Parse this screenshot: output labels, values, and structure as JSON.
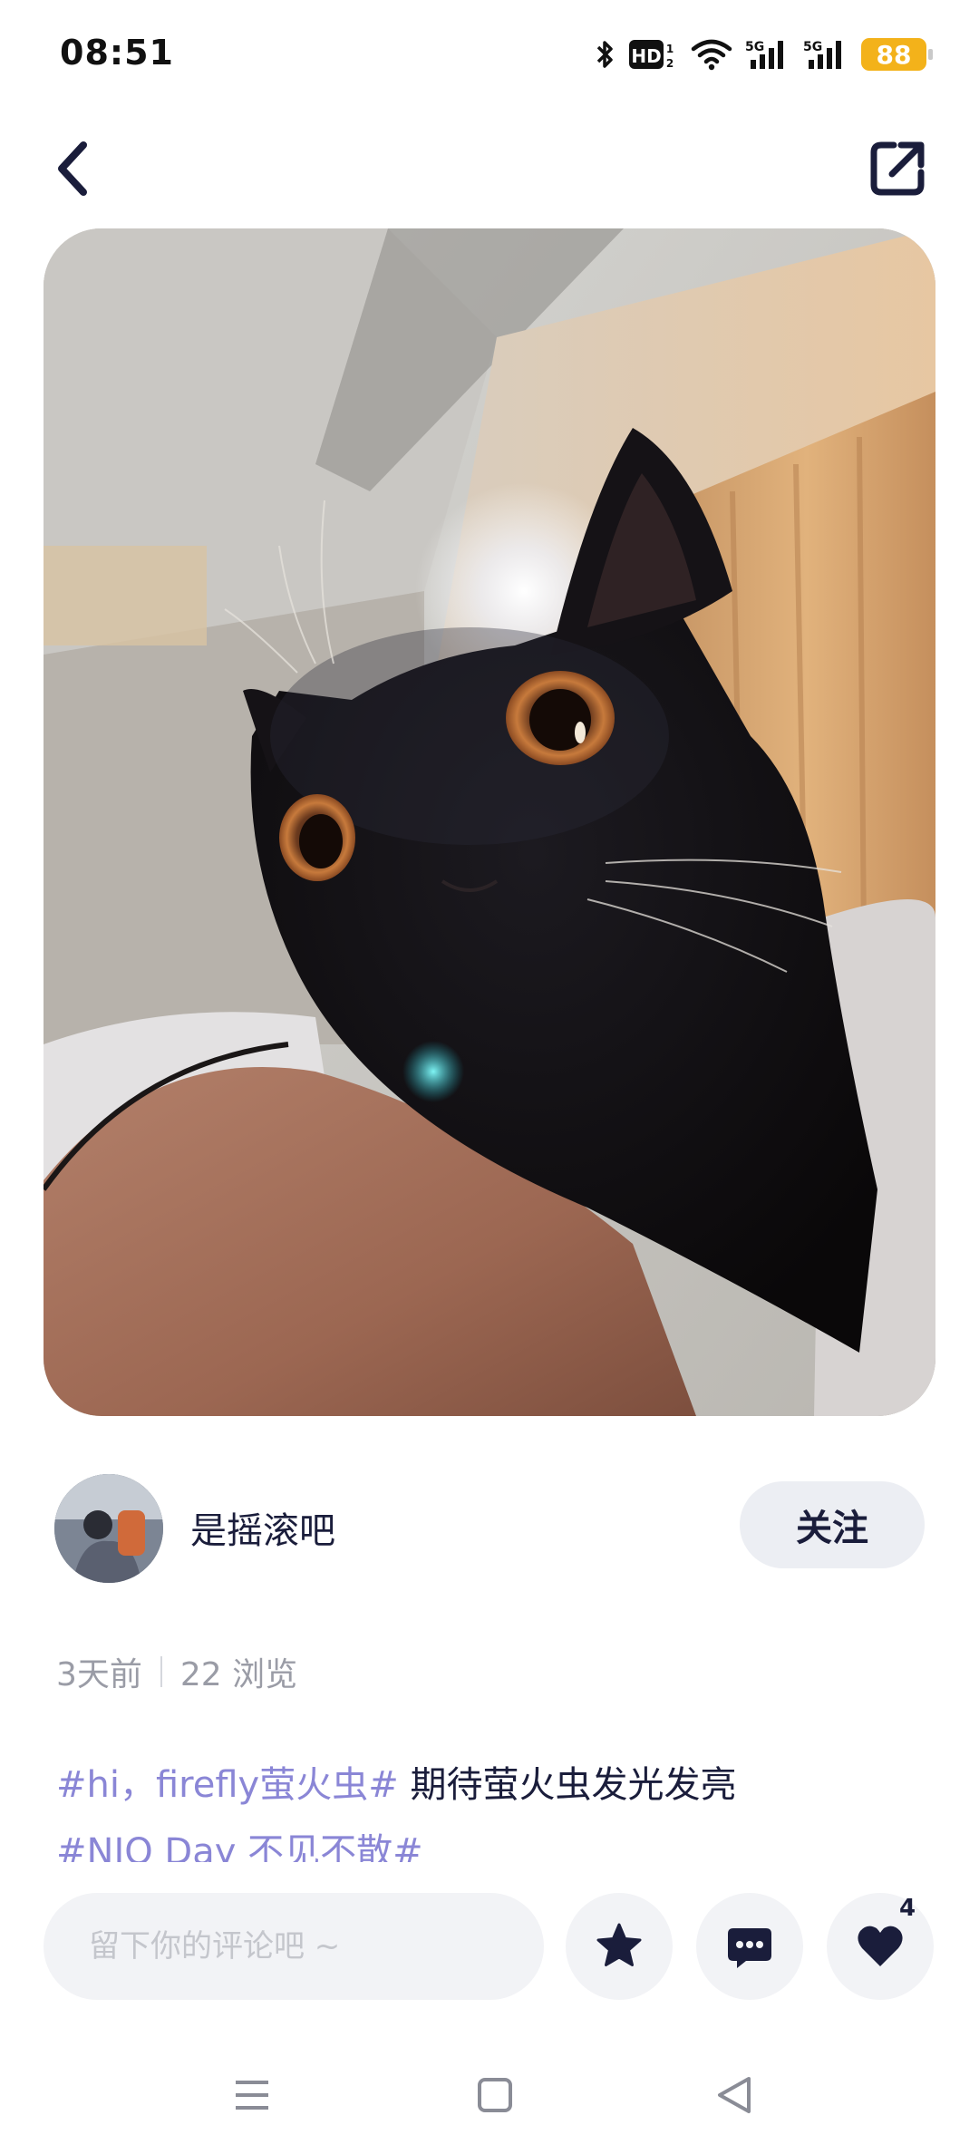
{
  "status_bar": {
    "time": "08:51",
    "battery": "88",
    "network_labels": [
      "HD",
      "5G",
      "5G"
    ]
  },
  "header": {
    "back_icon": "chevron-left-icon",
    "share_icon": "share-external-icon"
  },
  "post": {
    "author": {
      "name": "是摇滚吧",
      "follow_label": "关注"
    },
    "meta": {
      "time_ago": "3天前",
      "views": "22 浏览"
    },
    "hashtag1": "#hi，firefly萤火虫#",
    "text1": " 期待萤火虫发光发亮",
    "hashtag2": "#NIO Day 不见不散#"
  },
  "bottom_bar": {
    "comment_placeholder": "留下你的评论吧 ~",
    "like_count": "4"
  },
  "colors": {
    "accent_text": "#1a1d3b",
    "hashtag": "#8a86d6",
    "battery": "#f3b21a",
    "button_bg": "#f2f3f6"
  }
}
